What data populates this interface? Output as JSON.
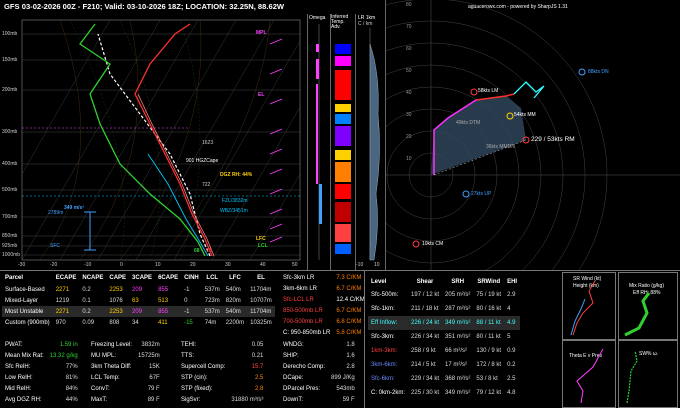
{
  "header": {
    "title": "GFS 03-02-2026 00Z - F210;  Valid: 03-10-2026 18Z;  LOCATION: 32.25N, 88.62W"
  },
  "colors": {
    "bg": "#000000",
    "temp": "#ff3030",
    "dewp": "#30d030",
    "wetbulb": "#00c8ff",
    "virtual": "#ff8080",
    "parcel": "#ffffff",
    "hodo_surface": "#ff30ff",
    "hodo_mid": "#ff3030",
    "hodo_upper": "#30ffff",
    "lbl_red": "#ff4040",
    "lbl_cyan": "#40ffff",
    "lbl_yellow": "#ffd000",
    "lbl_mag": "#ff40ff"
  },
  "skewt": {
    "pressure_labels": [
      "100mb",
      "150mb",
      "200mb",
      "300mb",
      "400mb",
      "500mb",
      "700mb",
      "850mb",
      "925mb",
      "1000mb"
    ],
    "temp_labels": [
      "-30",
      "-20",
      "-10",
      "0",
      "10",
      "20",
      "30",
      "40",
      "50"
    ],
    "height_labels": [
      "19km",
      "16km",
      "13km",
      "12km",
      "8km",
      "6km",
      "4km",
      "2km",
      "1km",
      "SFC"
    ],
    "annotations": {
      "mpl": "MPL",
      "el": "EL",
      "hgz": "901 HGZCape",
      "dgz": "DGZ RH: 44%",
      "ml": "349 m/s²",
      "lcl": "LCL",
      "lfc": "LFC",
      "sfc_temp": "68",
      "sfc_dewp": "71",
      "wbz": "WBZ/3451m",
      "fz": "FZL/3832m",
      "h2789": "2789m",
      "sfc": "SFC",
      "p1623": "1623",
      "p722": "722"
    }
  },
  "omega": {
    "title": "Omega",
    "unit": "-10 0 10"
  },
  "inferred": {
    "title": "Inferred Temp. Adv.",
    "sub": "(C/hr)"
  },
  "lr": {
    "title": "LR 1km",
    "sub": "C / km",
    "ticks": [
      "-10",
      "0",
      "10"
    ]
  },
  "hodo": {
    "credit": "aguacerowx.com - powered by SharpJS 1.31",
    "rings": [
      "80",
      "70",
      "60",
      "50",
      "40",
      "30",
      "20",
      "10"
    ],
    "labels": {
      "bunkers_lm": "58kts LM",
      "mean": "54kts MM",
      "rm": "229 / 53kts RM",
      "dtm": "49kts DTM",
      "cm": "10kts CM",
      "up": "27kts UP",
      "dn": "88kts DN",
      "v_mdn": "36kts MMDN"
    }
  },
  "parcel_table": {
    "headers": [
      "Parcel",
      "ECAPE",
      "NCAPE",
      "CAPE",
      "3CAPE",
      "6CAPE",
      "CINH",
      "LCL",
      "LFC",
      "EL"
    ],
    "rows": [
      [
        "Surface-Based",
        "2271",
        "0.2",
        "2253",
        "209",
        "855",
        "-1",
        "537m",
        "540m",
        "11704m"
      ],
      [
        "Mixed-Layer",
        "1219",
        "0.1",
        "1076",
        "63",
        "513",
        "0",
        "723m",
        "820m",
        "10707m"
      ],
      [
        "Most Unstable",
        "2271",
        "0.2",
        "2253",
        "209",
        "855",
        "-1",
        "537m",
        "540m",
        "11704m"
      ],
      [
        "Custom (900mb)",
        "970",
        "0.09",
        "808",
        "34",
        "411",
        "-15",
        "74m",
        "2200m",
        "10325m"
      ]
    ]
  },
  "lr_table": {
    "rows": [
      [
        "Sfc-3km LR",
        "7.3 C/KM"
      ],
      [
        "3km-6km LR",
        "6.7 C/KM"
      ],
      [
        "Sfc-LCL LR",
        "12.4 C/KM"
      ],
      [
        "850-500mb LR",
        "6.7 C/KM"
      ],
      [
        "700-500mb LR",
        "6.8 C/KM"
      ],
      [
        "C: 950-850mb LR",
        "5.8 C/KM"
      ]
    ]
  },
  "kin_table": {
    "headers": [
      "Level",
      "Shear",
      "SRH",
      "SRWind",
      "EHI"
    ],
    "rows": [
      [
        "Sfc-500m:",
        "197 / 12 kt",
        "205 m²/s²",
        "75 / 19 kt",
        "2.9"
      ],
      [
        "Sfc-1km:",
        "211 / 18 kt",
        "287 m²/s²",
        "80 / 16 kt",
        "4"
      ],
      [
        "Eff Inflow:",
        "226 / 24 kt",
        "349 m²/s²",
        "88 / 11 kt",
        "4.9"
      ],
      [
        "Sfc-3km:",
        "226 / 34 kt",
        "351 m²/s²",
        "80 / 11 kt",
        "5"
      ],
      [
        "1km-3km:",
        "258 / 9 kt",
        "66 m²/s²",
        "130 / 9 kt",
        "0.9"
      ],
      [
        "3km-6km:",
        "214 / 5 kt",
        "17 m²/s²",
        "172 / 8 kt",
        "0.2"
      ],
      [
        "Sfc-6km:",
        "229 / 34 kt",
        "368 m²/s²",
        "53 / 8 kt",
        "2.5"
      ],
      [
        "C: 0km-2km:",
        "225 / 30 kt",
        "349 m²/s²",
        "79 / 12 kt",
        "4.8"
      ]
    ]
  },
  "idx1": [
    [
      "PWAT:",
      "1.59 in"
    ],
    [
      "Mean Mix Rat:",
      "13.32 g/kg"
    ],
    [
      "Sfc RelH:",
      "77%"
    ],
    [
      "Low RelH:",
      "81%"
    ],
    [
      "Mid RelH:",
      "84%"
    ],
    [
      "Avg DGZ RH:",
      "44%"
    ]
  ],
  "idx2": [
    [
      "Freezing Level:",
      "3832m"
    ],
    [
      "MU MPL:",
      "15725m"
    ],
    [
      "3km Theta Diff:",
      "15K"
    ],
    [
      "LCL Temp:",
      "67F"
    ],
    [
      "ConvT:",
      "79 F"
    ],
    [
      "MaxT:",
      "89 F"
    ]
  ],
  "idx3": [
    [
      "TEHI:",
      "0.05"
    ],
    [
      "TTS:",
      "0.21"
    ],
    [
      "Supercell Comp:",
      "15.7"
    ],
    [
      "STP (cin):",
      "2.5"
    ],
    [
      "STP (fixed):",
      "2.8"
    ],
    [
      "SigSvr:",
      "31880 m³/s³"
    ]
  ],
  "idx4": [
    [
      "WNDG:",
      "1.8"
    ],
    [
      "SHIP:",
      "1.6"
    ],
    [
      "Derecho Comp:",
      "2.8"
    ],
    [
      "DCape:",
      "899 J/Kg"
    ],
    [
      "DParcel Pres:",
      "543mb"
    ],
    [
      "DownT:",
      "59 F"
    ]
  ],
  "mini": {
    "m1": "SR Wind (kt)",
    "m1b": "Height (km)",
    "m2": "Mix Ratio (g/kg)",
    "m2b": "Eff RH: 88%",
    "m3": "Theta E v Pres",
    "m4": "SW% ω."
  }
}
